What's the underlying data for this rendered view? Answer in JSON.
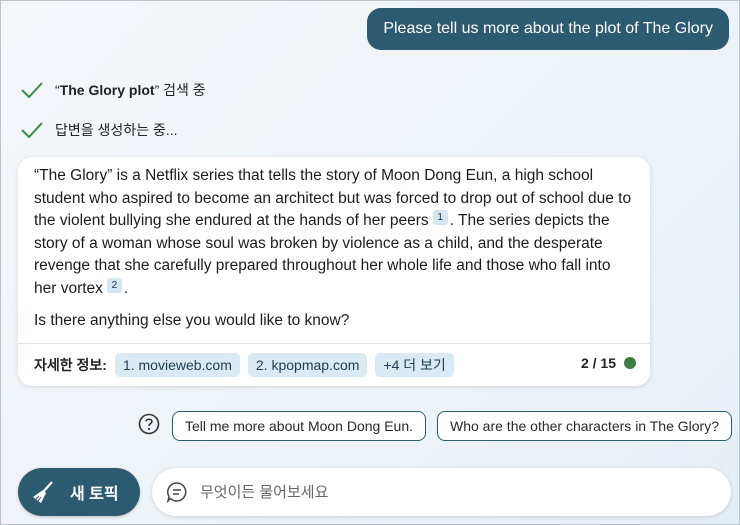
{
  "user_message": "Please tell us more about the plot of The Glory",
  "steps": [
    {
      "prefix": "“",
      "bold": "The Glory plot",
      "suffix": "” 검색 중"
    },
    {
      "prefix": "",
      "bold": "",
      "suffix": "답변을 생성하는 중..."
    }
  ],
  "answer": {
    "part1": "“The Glory” is a Netflix series that tells the story of Moon Dong Eun, a high school student who aspired to become an architect but was forced to drop out of school due to the violent bullying she endured at the hands of her peers",
    "cite1": "1",
    "part2": ". The series depicts the story of a woman whose soul was broken by violence as a child, and the desperate revenge that she carefully prepared throughout her whole life and those who fall into her vortex",
    "cite2": "2",
    "part3": ".",
    "follow_up": "Is there anything else you would like to know?"
  },
  "sources": {
    "label": "자세한 정보:",
    "items": [
      "1. movieweb.com",
      "2. kpopmap.com"
    ],
    "more": "+4 더 보기"
  },
  "counter": "2 / 15",
  "suggestions": [
    "Tell me more about Moon Dong Eun.",
    "Who are the other characters in The Glory?"
  ],
  "new_topic_label": "새 토픽",
  "input": {
    "placeholder": "무엇이든 물어보세요",
    "value": ""
  },
  "icons": {
    "check": "check-icon",
    "help": "question-circle-icon",
    "broom": "broom-icon",
    "chat": "chat-bubble-icon"
  },
  "colors": {
    "accent": "#2c5a70",
    "chip_bg": "#d9eaf4",
    "check": "#3d8a4a",
    "status_dot": "#3a7d44"
  }
}
